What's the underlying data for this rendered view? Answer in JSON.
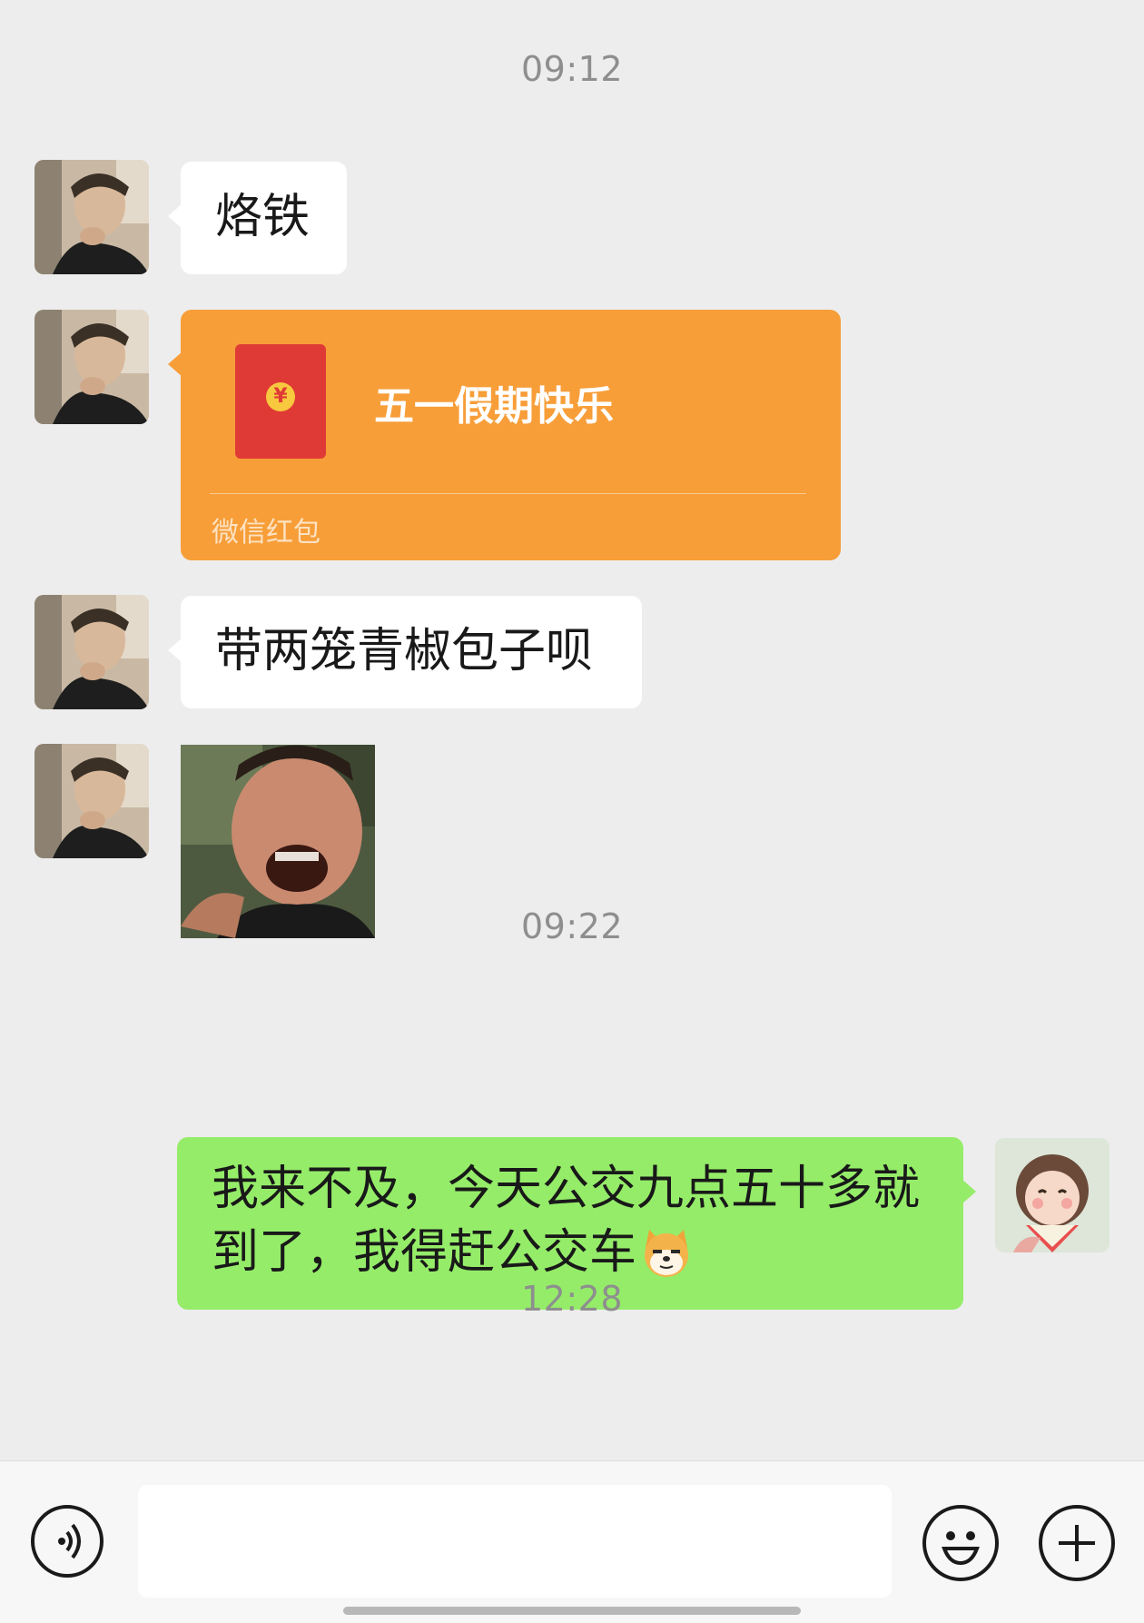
{
  "timestamps": [
    "09:12",
    "09:22",
    "12:28"
  ],
  "messages": {
    "m1": "烙铁",
    "red_packet": {
      "title": "五一假期快乐",
      "label": "微信红包"
    },
    "m3": "带两笼青椒包子呗",
    "m5_line1": "我来不及，今天公交九点五十多就",
    "m5_line2": "到了，我得赶公交车"
  },
  "icons": {
    "coin": "¥",
    "voice": "voice-icon",
    "emoji": "emoji-icon",
    "plus": "plus-icon",
    "shiba_emoji": "shiba-emoji-icon"
  },
  "input": {
    "placeholder": ""
  },
  "colors": {
    "background": "#EDEDED",
    "incoming_bubble": "#FFFFFF",
    "outgoing_bubble": "#95EC69",
    "red_packet": "#F79E39",
    "timestamp": "#8E8E8E"
  }
}
